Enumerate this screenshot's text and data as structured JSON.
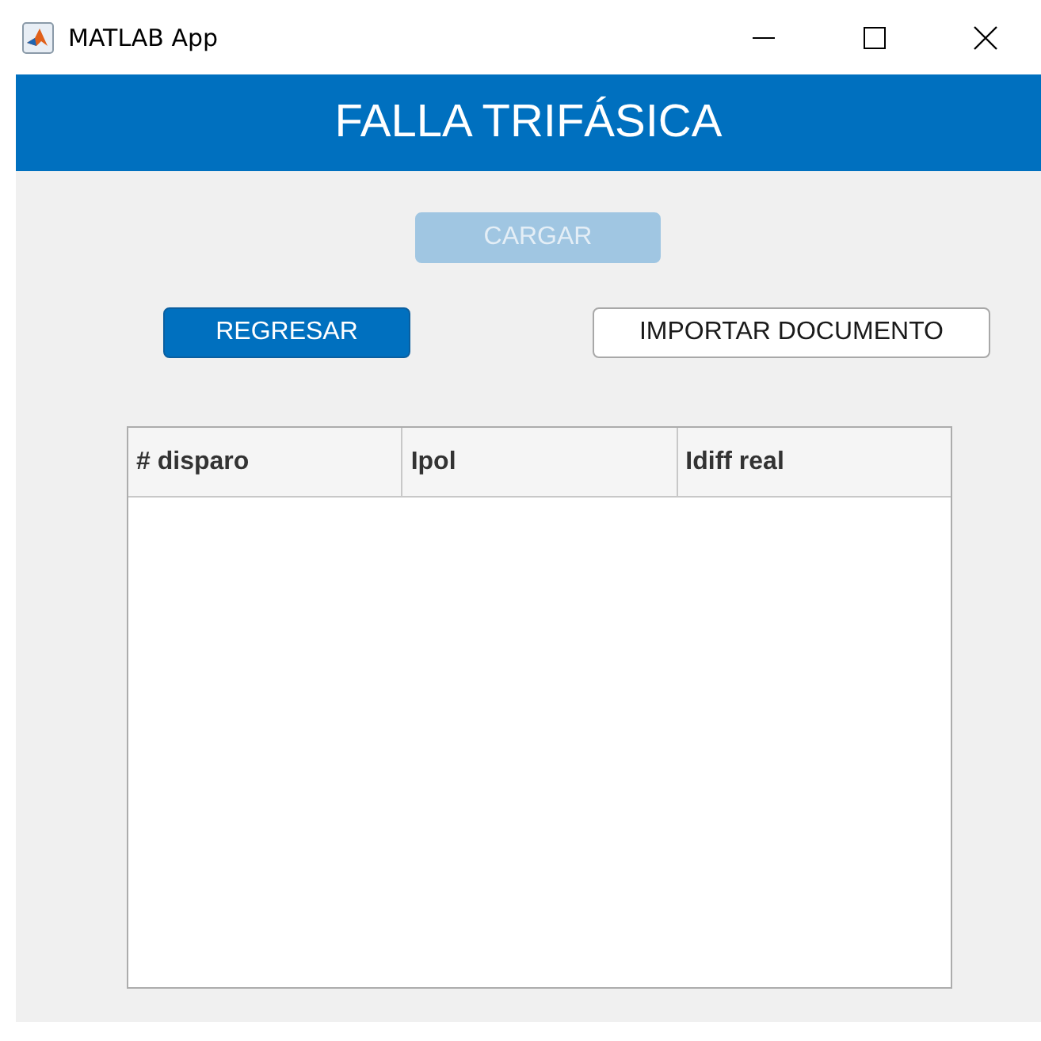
{
  "window": {
    "title": "MATLAB App"
  },
  "header": {
    "title": "FALLA TRIFÁSICA"
  },
  "buttons": [
    {
      "label": "CARGAR",
      "kind": "primary",
      "disabled": true
    },
    {
      "label": "REGRESAR",
      "kind": "primary",
      "disabled": false
    },
    {
      "label": "IMPORTAR DOCUMENTO",
      "kind": "default",
      "disabled": false
    }
  ],
  "table": {
    "columns": [
      "# disparo",
      "Ipol",
      "Idiff real"
    ]
  }
}
